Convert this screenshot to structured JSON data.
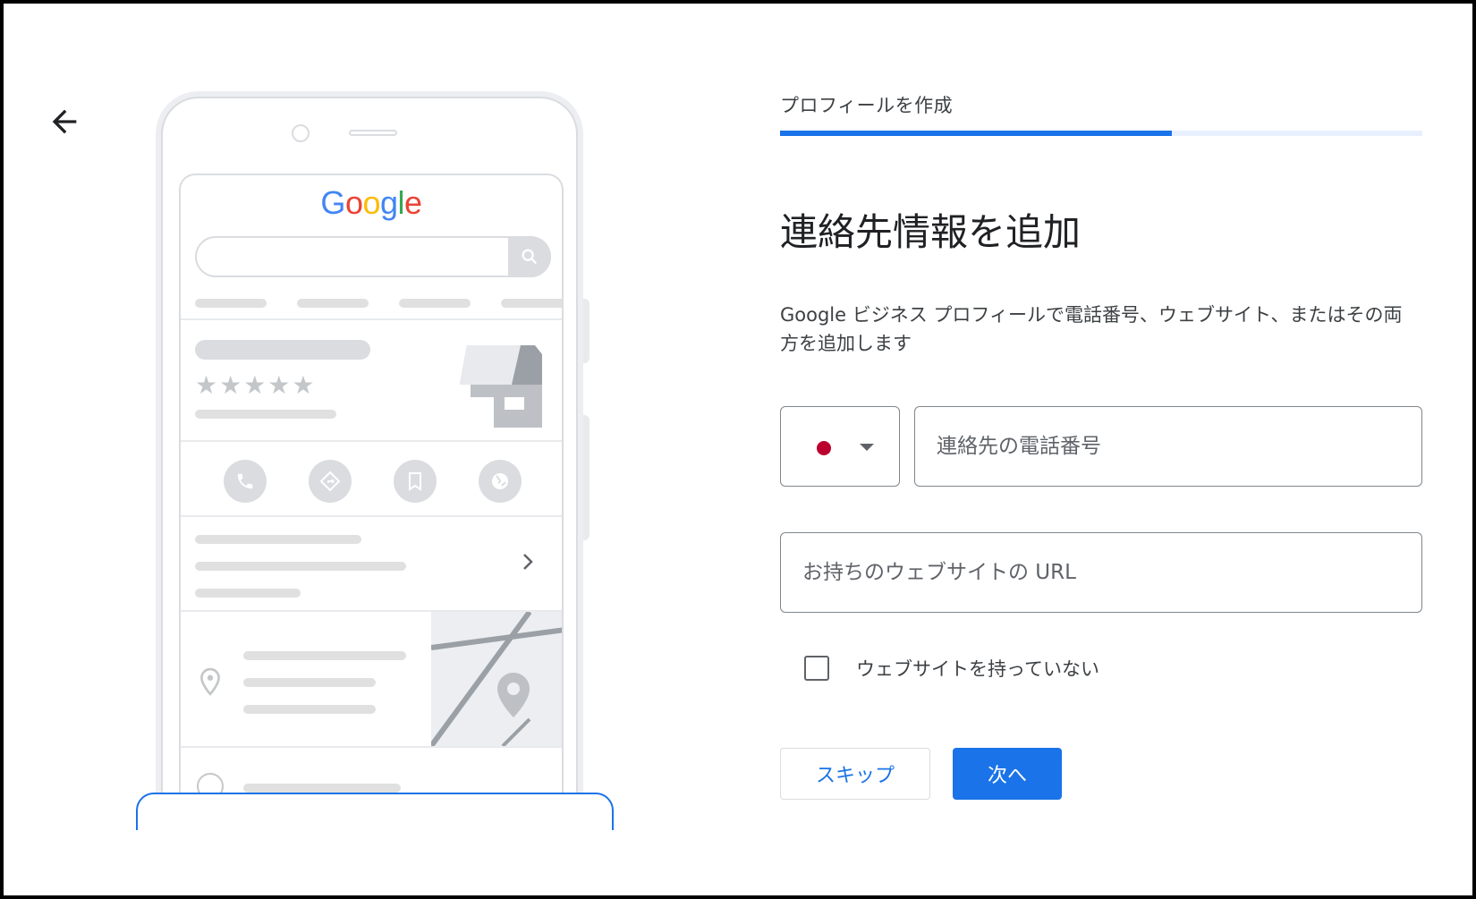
{
  "header": {
    "step_label": "プロフィールを作成",
    "progress_fraction": 0.61
  },
  "main": {
    "title": "連絡先情報を追加",
    "description": "Google ビジネス プロフィールで電話番号、ウェブサイト、またはその両方を追加します",
    "country_select": {
      "selected_flag": "japan-flag-icon"
    },
    "phone_field": {
      "placeholder": "連絡先の電話番号",
      "value": ""
    },
    "url_field": {
      "placeholder": "お持ちのウェブサイトの URL",
      "value": ""
    },
    "no_website_checkbox": {
      "label": "ウェブサイトを持っていない",
      "checked": false
    },
    "skip_label": "スキップ",
    "next_label": "次へ"
  },
  "illustration": {
    "logo_text": "Google",
    "rating_stars": 5
  },
  "colors": {
    "accent": "#1a73e8",
    "progress_track": "#e8f0fe",
    "flag_red": "#bc002d"
  }
}
